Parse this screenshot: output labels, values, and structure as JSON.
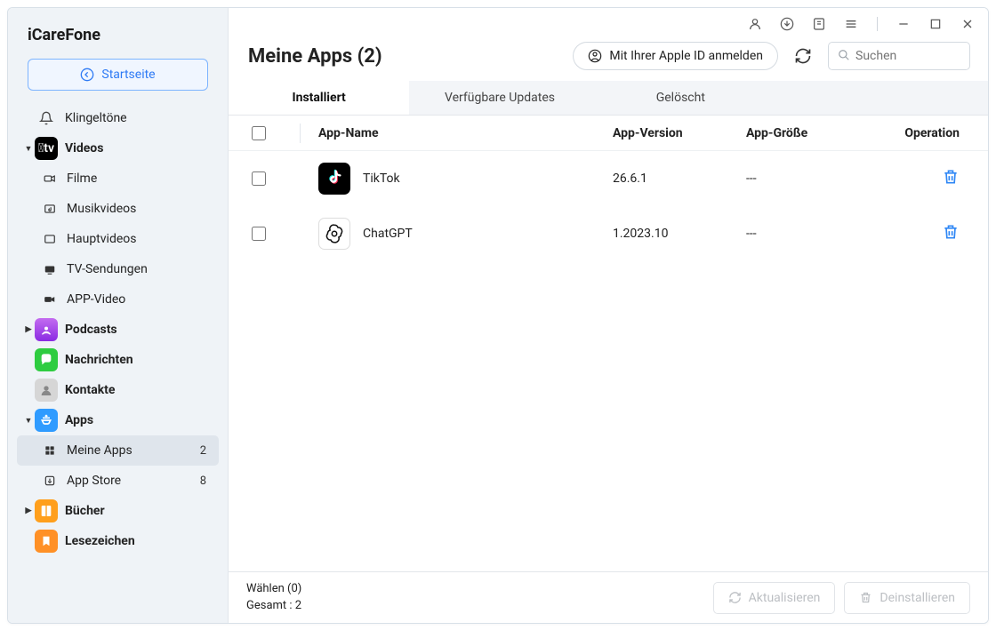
{
  "brand": "iCareFone",
  "home_label": "Startseite",
  "sidebar": {
    "ringtones": "Klingeltöne",
    "videos": "Videos",
    "videos_children": {
      "filme": "Filme",
      "musikvideos": "Musikvideos",
      "hauptvideos": "Hauptvideos",
      "tv": "TV-Sendungen",
      "appvideo": "APP-Video"
    },
    "podcasts": "Podcasts",
    "nachrichten": "Nachrichten",
    "kontakte": "Kontakte",
    "apps": "Apps",
    "apps_children": {
      "meine": "Meine Apps",
      "meine_count": "2",
      "store": "App Store",
      "store_count": "8"
    },
    "buecher": "Bücher",
    "lesezeichen": "Lesezeichen"
  },
  "page": {
    "title": "Meine Apps (2)",
    "signin": "Mit Ihrer Apple ID anmelden",
    "search_placeholder": "Suchen"
  },
  "tabs": {
    "installed": "Installiert",
    "updates": "Verfügbare Updates",
    "deleted": "Gelöscht"
  },
  "columns": {
    "name": "App-Name",
    "version": "App-Version",
    "size": "App-Größe",
    "operation": "Operation"
  },
  "rows": [
    {
      "name": "TikTok",
      "version": "26.6.1",
      "size": "---",
      "icon": "tiktok"
    },
    {
      "name": "ChatGPT",
      "version": "1.2023.10",
      "size": "---",
      "icon": "chatgpt"
    }
  ],
  "footer": {
    "choose": "Wählen (0)",
    "total": "Gesamt : 2",
    "refresh": "Aktualisieren",
    "uninstall": "Deinstallieren"
  }
}
